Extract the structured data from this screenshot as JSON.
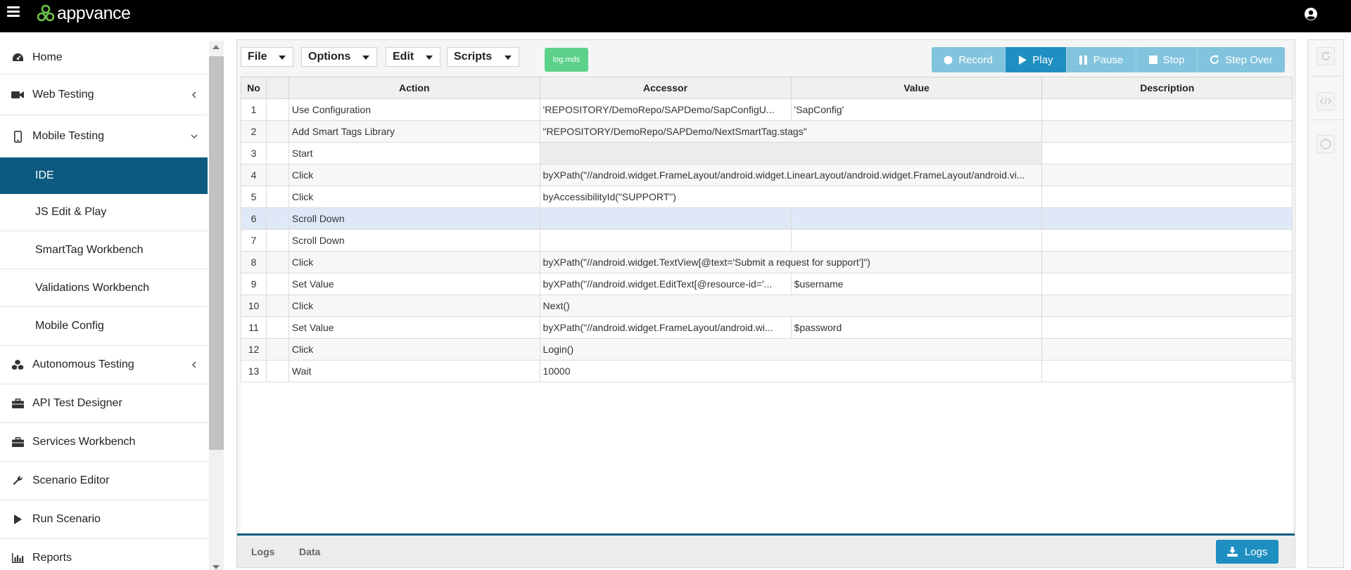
{
  "app": {
    "brand": "appvance"
  },
  "sidebar": {
    "items": [
      {
        "label": "Home",
        "icon": "dashboard-icon"
      },
      {
        "label": "Web Testing",
        "icon": "video-camera-icon"
      },
      {
        "label": "Mobile Testing",
        "icon": "mobile-phone-icon"
      },
      {
        "label": "Autonomous Testing",
        "icon": "cubes-icon"
      },
      {
        "label": "API Test Designer",
        "icon": "briefcase-icon"
      },
      {
        "label": "Services Workbench",
        "icon": "briefcase-icon"
      },
      {
        "label": "Scenario Editor",
        "icon": "wrench-icon"
      },
      {
        "label": "Run Scenario",
        "icon": "play-icon"
      },
      {
        "label": "Reports",
        "icon": "bar-chart-icon"
      }
    ],
    "mobile_sub": [
      "IDE",
      "JS Edit & Play",
      "SmartTag Workbench",
      "Validations Workbench",
      "Mobile Config"
    ]
  },
  "toolbar": {
    "menus": [
      "File",
      "Options",
      "Edit",
      "Scripts"
    ],
    "tag": "log.mds",
    "record": "Record",
    "play": "Play",
    "pause": "Pause",
    "stop": "Stop",
    "step_over": "Step Over"
  },
  "table": {
    "headers": {
      "no": "No",
      "action": "Action",
      "accessor": "Accessor",
      "value": "Value",
      "description": "Description"
    },
    "rows": [
      {
        "no": "1",
        "action": "Use Configuration",
        "accessor": "'REPOSITORY/DemoRepo/SAPDemo/SapConfigU...",
        "value": "'SapConfig'",
        "description": ""
      },
      {
        "no": "2",
        "action": "Add Smart Tags Library",
        "accessor": "\"REPOSITORY/DemoRepo/SAPDemo/NextSmartTag.stags\"",
        "value": "",
        "description": ""
      },
      {
        "no": "3",
        "action": "Start",
        "accessor": "",
        "value": "",
        "description": ""
      },
      {
        "no": "4",
        "action": "Click",
        "accessor": "byXPath(\"//android.widget.FrameLayout/android.widget.LinearLayout/android.widget.FrameLayout/android.vi...",
        "value": "",
        "description": ""
      },
      {
        "no": "5",
        "action": "Click",
        "accessor": "byAccessibilityId(\"SUPPORT\")",
        "value": "",
        "description": ""
      },
      {
        "no": "6",
        "action": "Scroll Down",
        "accessor": "",
        "value": "",
        "description": ""
      },
      {
        "no": "7",
        "action": "Scroll Down",
        "accessor": "",
        "value": "",
        "description": ""
      },
      {
        "no": "8",
        "action": "Click",
        "accessor": "byXPath(\"//android.widget.TextView[@text='Submit a request for support']\")",
        "value": "",
        "description": ""
      },
      {
        "no": "9",
        "action": "Set Value",
        "accessor": "byXPath(\"//android.widget.EditText[@resource-id='...",
        "value": "$username",
        "description": ""
      },
      {
        "no": "10",
        "action": "Click",
        "accessor": "Next()",
        "value": "",
        "description": ""
      },
      {
        "no": "11",
        "action": "Set Value",
        "accessor": "byXPath(\"//android.widget.FrameLayout/android.wi...",
        "value": "$password",
        "description": ""
      },
      {
        "no": "12",
        "action": "Click",
        "accessor": "Login()",
        "value": "",
        "description": ""
      },
      {
        "no": "13",
        "action": "Wait",
        "accessor": "10000",
        "value": "",
        "description": ""
      }
    ]
  },
  "bottom": {
    "tab_logs": "Logs",
    "tab_data": "Data",
    "logs_button": "Logs"
  },
  "colors": {
    "active_nav": "#0c5a80",
    "play": "#1f8fc1",
    "play_light": "#82c3dd",
    "tag": "#5cd189"
  }
}
